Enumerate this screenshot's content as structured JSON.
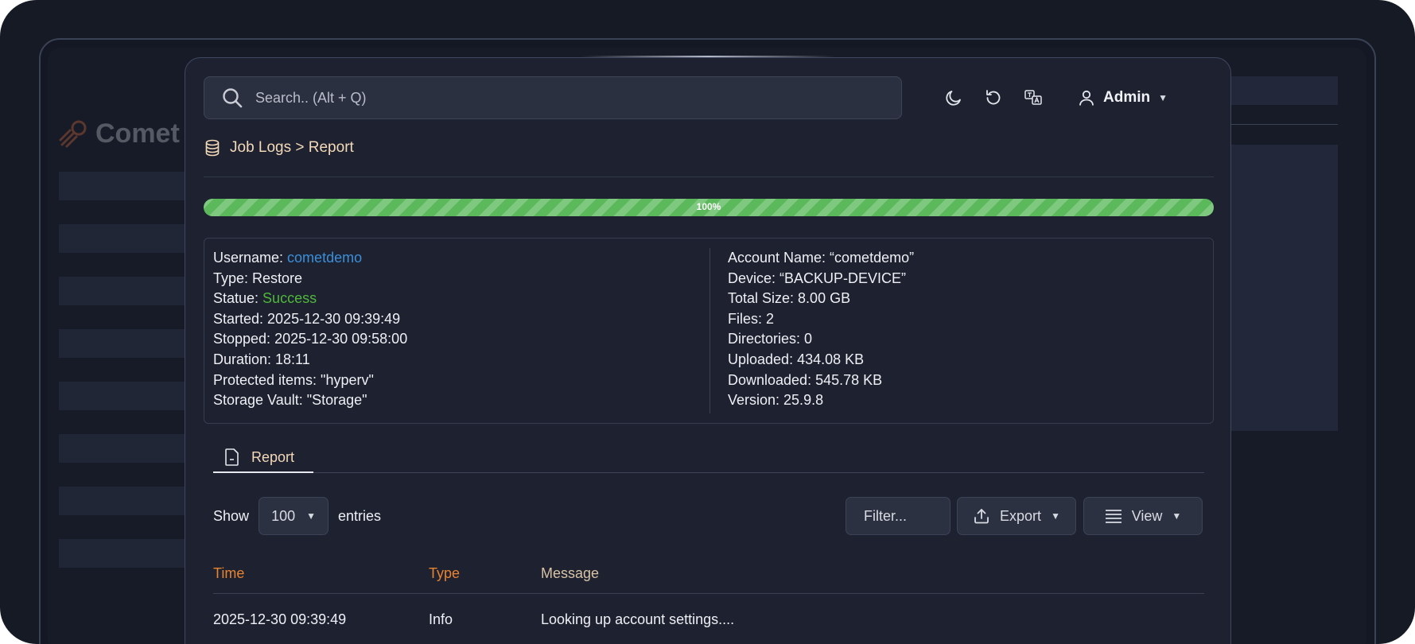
{
  "background": {
    "logo_text": "Comet I"
  },
  "search": {
    "placeholder": "Search.. (Alt + Q)"
  },
  "top_icons": [
    "moon-icon",
    "refresh-icon",
    "translate-icon"
  ],
  "user": {
    "name": "Admin"
  },
  "breadcrumb": {
    "text": "Job Logs > Report"
  },
  "progress": {
    "value": 100,
    "label": "100%",
    "color": "#5bb85b"
  },
  "details": {
    "left": {
      "username_label": "Username: ",
      "username_value": "cometdemo",
      "type": "Type: Restore",
      "status_label": "Statue: ",
      "status_value": "Success",
      "started": "Started: 2025-12-30 09:39:49",
      "stopped": "Stopped: 2025-12-30 09:58:00",
      "duration": "Duration: 18:11",
      "protected_items": "Protected items: \"hyperv\"",
      "storage_vault": "Storage Vault: \"Storage\""
    },
    "right": {
      "account_name": "Account Name: “cometdemo”",
      "device": "Device: “BACKUP-DEVICE”",
      "total_size": "Total Size: 8.00  GB",
      "files": "Files: 2",
      "directories": "Directories: 0",
      "uploaded": "Uploaded: 434.08 KB",
      "downloaded": "Downloaded: 545.78 KB",
      "version": "Version: 25.9.8"
    }
  },
  "tabs": {
    "report": "Report"
  },
  "controls": {
    "show_label": "Show",
    "entries_value": "100",
    "entries_label": "entries",
    "filter_placeholder": "Filter...",
    "export_label": "Export",
    "view_label": "View"
  },
  "table": {
    "headers": [
      {
        "label": "Time",
        "color": "#e8832f"
      },
      {
        "label": "Type",
        "color": "#e8832f"
      },
      {
        "label": "Message",
        "color": "#d9c3a5"
      }
    ],
    "rows": [
      {
        "time": "2025-12-30 09:39:49",
        "type": "Info",
        "message": "Looking up account settings...."
      }
    ]
  },
  "colors": {
    "link": "#3b8fd8",
    "success": "#4fb83b",
    "accent_text": "#f3d9b8"
  }
}
